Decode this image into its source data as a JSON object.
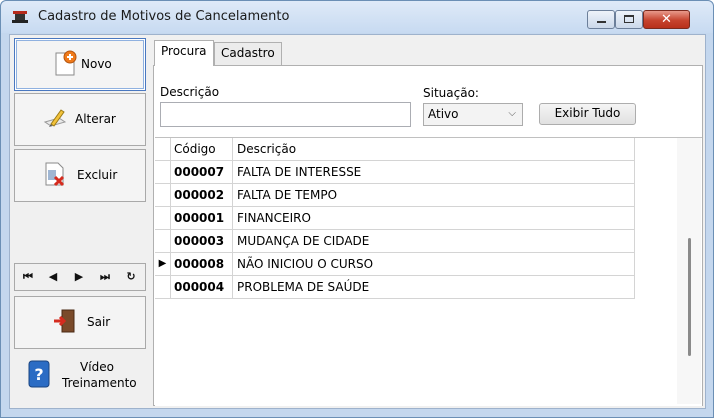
{
  "window": {
    "title": "Cadastro de Motivos de Cancelamento",
    "close_glyph": "✕"
  },
  "sidebar": {
    "novo": "Novo",
    "alterar": "Alterar",
    "excluir": "Excluir",
    "sair": "Sair",
    "video_line1": "Vídeo",
    "video_line2": "Treinamento",
    "nav": {
      "first": "⏮",
      "prev": "◀",
      "next": "▶",
      "last": "⏭",
      "refresh": "↻"
    }
  },
  "tabs": [
    {
      "label": "Procura",
      "active": true
    },
    {
      "label": "Cadastro",
      "active": false
    }
  ],
  "search": {
    "descricao_label": "Descrição",
    "descricao_value": "",
    "situacao_label": "Situação:",
    "situacao_value": "Ativo",
    "exibir_tudo": "Exibir Tudo"
  },
  "grid": {
    "columns": [
      "Código",
      "Descrição"
    ],
    "rows": [
      {
        "codigo": "000007",
        "descricao": "FALTA DE INTERESSE",
        "current": false
      },
      {
        "codigo": "000002",
        "descricao": "FALTA DE TEMPO",
        "current": false
      },
      {
        "codigo": "000001",
        "descricao": "FINANCEIRO",
        "current": false
      },
      {
        "codigo": "000003",
        "descricao": "MUDANÇA DE CIDADE",
        "current": false
      },
      {
        "codigo": "000008",
        "descricao": "NÃO INICIOU O CURSO",
        "current": true
      },
      {
        "codigo": "000004",
        "descricao": "PROBLEMA DE SAÚDE",
        "current": false
      }
    ],
    "current_marker": "▶"
  }
}
